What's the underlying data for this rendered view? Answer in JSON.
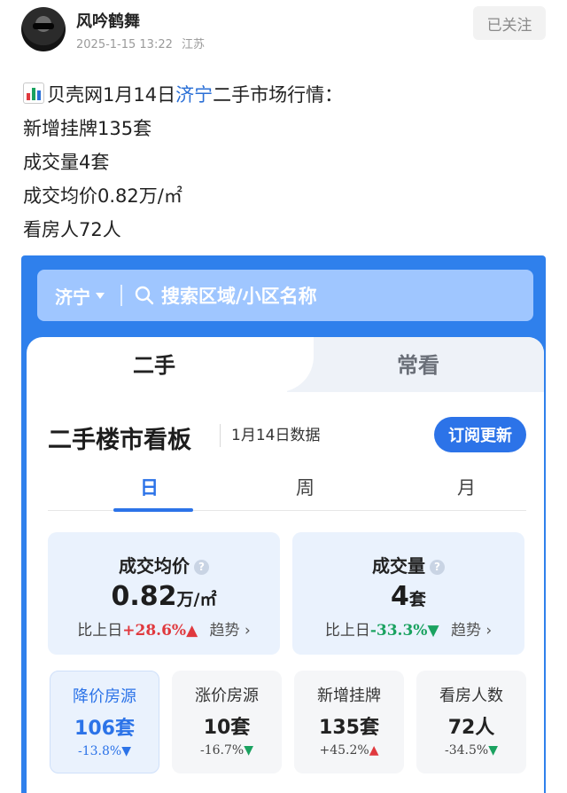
{
  "post": {
    "author": "风吟鹤舞",
    "date": "2025-1-15 13:22",
    "location": "江苏",
    "follow_label": "已关注",
    "line1_prefix": "贝壳网1月14日",
    "line1_city": "济宁",
    "line1_suffix": "二手市场行情：",
    "line2": "新增挂牌135套",
    "line3": "成交量4套",
    "line4": "成交均价0.82万/㎡",
    "line5": "看房人72人",
    "emoji": "bar-chart-emoji"
  },
  "app": {
    "search": {
      "city": "济宁",
      "placeholder": "搜索区域/小区名称"
    },
    "tabs": [
      "二手",
      "常看"
    ],
    "board": {
      "title": "二手楼市看板",
      "date": "1月14日数据",
      "subscribe_label": "订阅更新"
    },
    "periods": [
      "日",
      "周",
      "月"
    ],
    "stats": [
      {
        "title": "成交均价",
        "value": "0.82",
        "unit": "万/㎡",
        "change_label": "比上日",
        "change": "+28.6%",
        "direction": "▲",
        "trend_label": "趋势"
      },
      {
        "title": "成交量",
        "value": "4",
        "unit": "套",
        "change_label": "比上日",
        "change": "-33.3%",
        "direction": "▼",
        "trend_label": "趋势"
      }
    ],
    "mini_stats": [
      {
        "title": "降价房源",
        "value": "106套",
        "change": "-13.8%",
        "direction": "▼"
      },
      {
        "title": "涨价房源",
        "value": "10套",
        "change": "-16.7%",
        "direction": "▼"
      },
      {
        "title": "新增挂牌",
        "value": "135套",
        "change": "+45.2%",
        "direction": "▲"
      },
      {
        "title": "看房人数",
        "value": "72人",
        "change": "-34.5%",
        "direction": "▼"
      }
    ]
  },
  "colors": {
    "accent": "#2c73e8",
    "up": "#e0393e",
    "down": "#1aa260",
    "link": "#2a6fd6"
  }
}
